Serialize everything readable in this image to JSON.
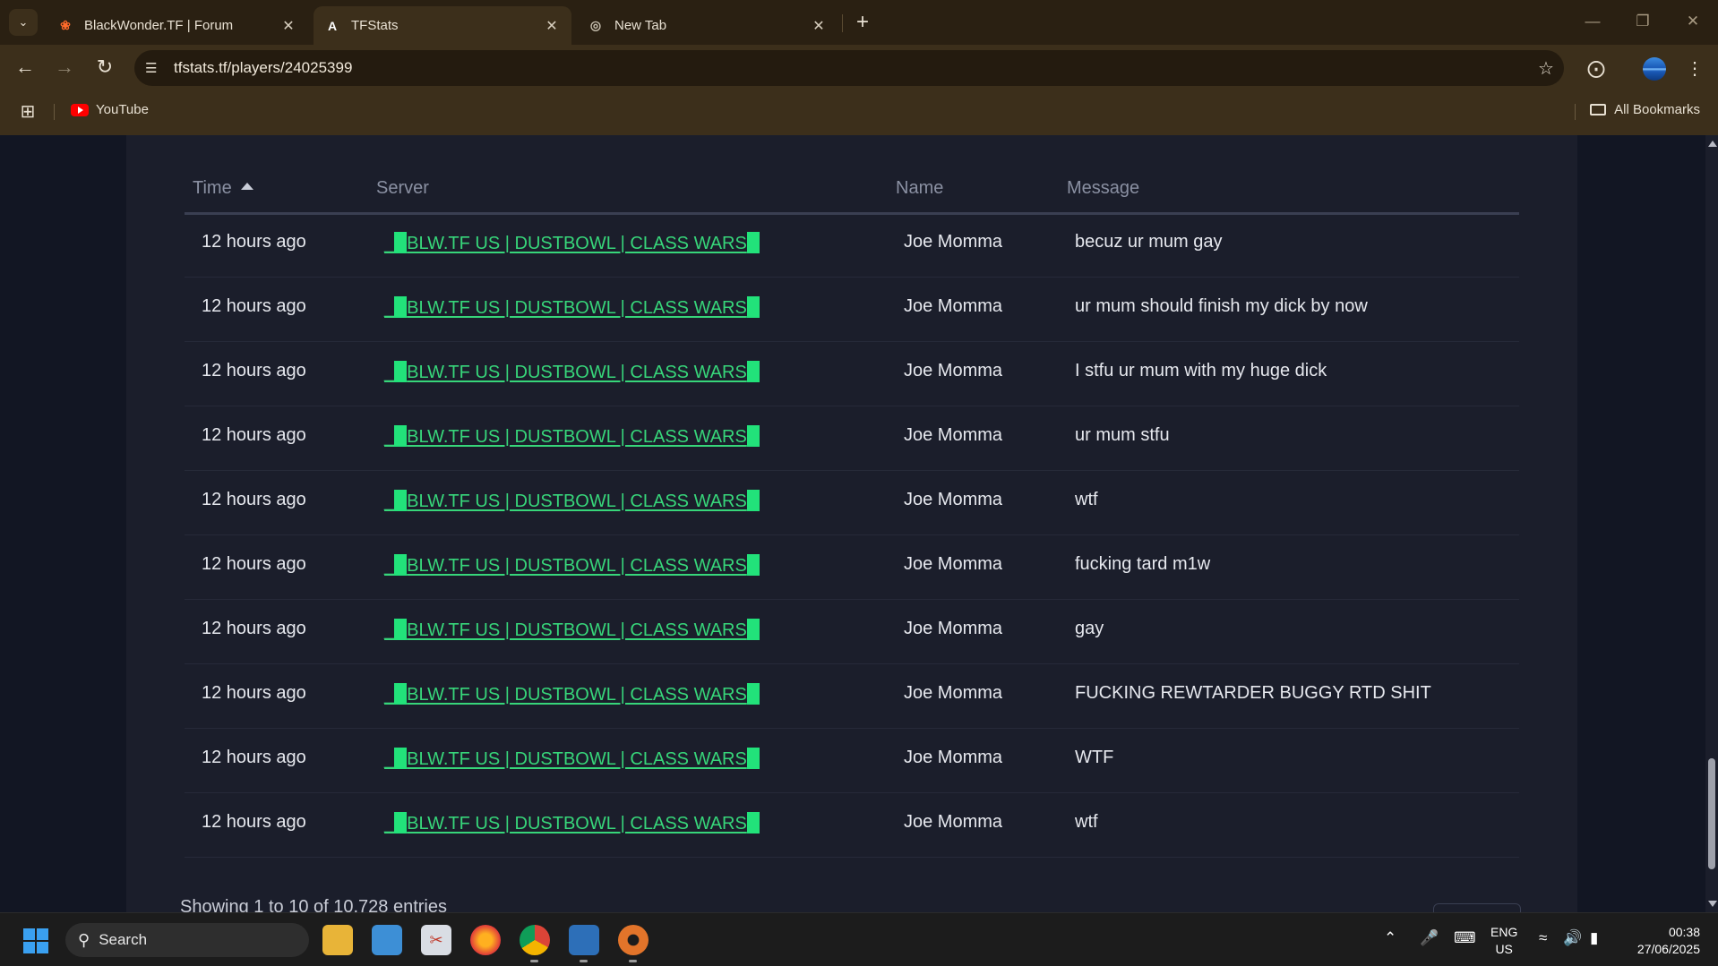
{
  "browser": {
    "tabs": [
      {
        "title": "BlackWonder.TF | Forum",
        "icon": "blackwonder-icon",
        "active": false
      },
      {
        "title": "TFStats",
        "icon": "tfstats-icon",
        "active": true
      },
      {
        "title": "New Tab",
        "icon": "chrome-icon",
        "active": false
      }
    ],
    "url": "tfstats.tf/players/24025399",
    "bookmarks": [
      {
        "label": "YouTube",
        "icon": "youtube-icon"
      }
    ],
    "all_bookmarks_label": "All Bookmarks"
  },
  "table": {
    "headers": {
      "time": "Time",
      "server": "Server",
      "name": "Name",
      "message": "Message"
    },
    "sort": {
      "column": "time",
      "direction": "ascending"
    },
    "rows": [
      {
        "time": "12 hours ago",
        "server": "BLW.TF US | DUSTBOWL | CLASS WARS",
        "name": "Joe Momma",
        "message": "becuz ur mum gay"
      },
      {
        "time": "12 hours ago",
        "server": "BLW.TF US | DUSTBOWL | CLASS WARS",
        "name": "Joe Momma",
        "message": "ur mum should finish my dick by now"
      },
      {
        "time": "12 hours ago",
        "server": "BLW.TF US | DUSTBOWL | CLASS WARS",
        "name": "Joe Momma",
        "message": "I stfu ur mum with my huge dick"
      },
      {
        "time": "12 hours ago",
        "server": "BLW.TF US | DUSTBOWL | CLASS WARS",
        "name": "Joe Momma",
        "message": "ur mum stfu"
      },
      {
        "time": "12 hours ago",
        "server": "BLW.TF US | DUSTBOWL | CLASS WARS",
        "name": "Joe Momma",
        "message": "wtf"
      },
      {
        "time": "12 hours ago",
        "server": "BLW.TF US | DUSTBOWL | CLASS WARS",
        "name": "Joe Momma",
        "message": "fucking tard m1w"
      },
      {
        "time": "12 hours ago",
        "server": "BLW.TF US | DUSTBOWL | CLASS WARS",
        "name": "Joe Momma",
        "message": "gay"
      },
      {
        "time": "12 hours ago",
        "server": "BLW.TF US | DUSTBOWL | CLASS WARS",
        "name": "Joe Momma",
        "message": "FUCKING REWTARDER BUGGY RTD SHIT"
      },
      {
        "time": "12 hours ago",
        "server": "BLW.TF US | DUSTBOWL | CLASS WARS",
        "name": "Joe Momma",
        "message": "WTF"
      },
      {
        "time": "12 hours ago",
        "server": "BLW.TF US | DUSTBOWL | CLASS WARS",
        "name": "Joe Momma",
        "message": "wtf"
      }
    ],
    "info": "Showing 1 to 10 of 10,728 entries"
  },
  "taskbar": {
    "search_label": "Search",
    "apps": [
      "file-explorer-icon",
      "control-panel-icon",
      "snipping-tool-icon",
      "firefox-icon",
      "chrome-icon",
      "remote-icon",
      "tf2-icon"
    ],
    "language": {
      "line1": "ENG",
      "line2": "US"
    },
    "time": "00:38",
    "date": "27/06/2025"
  },
  "colors": {
    "page_bg": "#121623",
    "card_bg": "#1b1e2b",
    "server_link": "#37d67a",
    "chrome_bg": "#3c2f1b"
  }
}
